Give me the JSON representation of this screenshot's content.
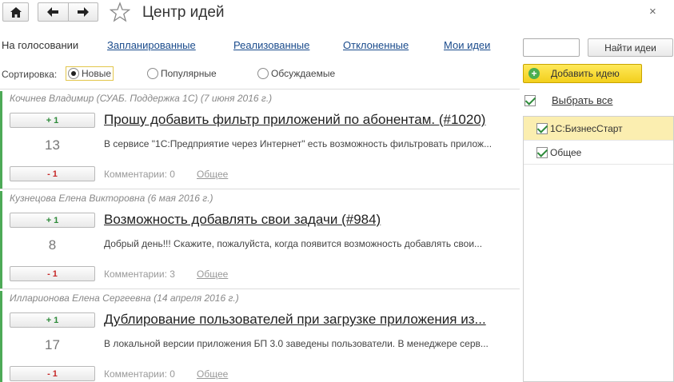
{
  "window": {
    "title": "Центр идей",
    "close_glyph": "×"
  },
  "tabs": [
    {
      "label": "На голосовании",
      "active": true
    },
    {
      "label": "Запланированные",
      "active": false
    },
    {
      "label": "Реализованные",
      "active": false
    },
    {
      "label": "Отклоненные",
      "active": false
    },
    {
      "label": "Мои идеи",
      "active": false
    }
  ],
  "sort": {
    "label": "Сортировка:",
    "options": [
      {
        "label": "Новые",
        "selected": true
      },
      {
        "label": "Популярные",
        "selected": false
      },
      {
        "label": "Обсуждаемые",
        "selected": false
      }
    ]
  },
  "ideas": [
    {
      "author": "Кочинев Владимир (СУАБ. Поддержка 1С) (7 июня 2016 г.)",
      "up_label": "+ 1",
      "votes": "13",
      "down_label": "- 1",
      "title": "Прошу добавить фильтр приложений по абонентам. (#1020)",
      "description": "В сервисе \"1С:Предприятие через Интернет\" есть возможность фильтровать прилож...",
      "comments": "Комментарии: 0",
      "category": "Общее"
    },
    {
      "author": "Кузнецова Елена Викторовна (6 мая 2016 г.)",
      "up_label": "+ 1",
      "votes": "8",
      "down_label": "- 1",
      "title": "Возможность добавлять свои задачи (#984)",
      "description": "Добрый день!!!  Скажите, пожалуйста, когда появится возможность добавлять свои...",
      "comments": "Комментарии: 3",
      "category": "Общее"
    },
    {
      "author": "Илларионова Елена Сергеевна (14 апреля 2016 г.)",
      "up_label": "+ 1",
      "votes": "17",
      "down_label": "- 1",
      "title": "Дублирование пользователей при загрузке приложения из...",
      "description": "В локальной версии приложения БП 3.0 заведены пользователи. В менеджере серв...",
      "comments": "Комментарии: 0",
      "category": "Общее"
    }
  ],
  "search": {
    "value": "",
    "button_label": "Найти идеи"
  },
  "add_idea": {
    "label": "Добавить идею"
  },
  "categories": {
    "select_all_label": "Выбрать все",
    "items": [
      {
        "label": "1С:БизнесСтарт",
        "checked": true,
        "selected": true
      },
      {
        "label": "Общее",
        "checked": true,
        "selected": false
      }
    ]
  },
  "colors": {
    "accent_green": "#4daa57",
    "link": "#1a4b8c",
    "add_button": "#f2cf1c",
    "selected_row": "#fbeeb0"
  }
}
